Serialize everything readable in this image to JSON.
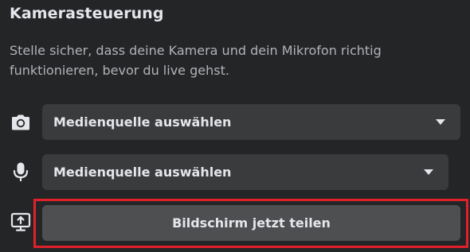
{
  "section": {
    "title": "Kamerasteuerung",
    "description": "Stelle sicher, dass deine Kamera und dein Mikrofon richtig funktionieren, bevor du live gehst."
  },
  "camera": {
    "icon": "camera-icon",
    "selected": "Medienquelle auswählen"
  },
  "microphone": {
    "icon": "microphone-icon",
    "selected": "Medienquelle auswählen"
  },
  "screen_share": {
    "icon": "screen-share-icon",
    "label": "Bildschirm jetzt teilen"
  },
  "colors": {
    "background": "#242526",
    "control": "#3a3b3c",
    "button": "#4e4f50",
    "text": "#e4e6eb",
    "secondary_text": "#b0b3b8",
    "highlight": "#e0202b"
  }
}
